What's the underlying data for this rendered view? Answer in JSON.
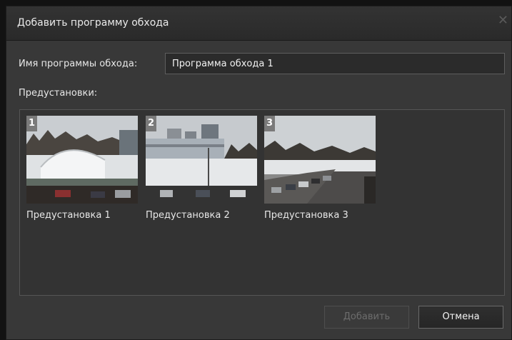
{
  "dialog": {
    "title": "Добавить программу обхода",
    "close_icon": "close-icon"
  },
  "form": {
    "name_label": "Имя программы обхода:",
    "name_value": "Программа обхода 1",
    "presets_label": "Предустановки:"
  },
  "presets": [
    {
      "number": "1",
      "label": "Предустановка 1"
    },
    {
      "number": "2",
      "label": "Предустановка 2"
    },
    {
      "number": "3",
      "label": "Предустановка 3"
    }
  ],
  "buttons": {
    "add_label": "Добавить",
    "add_enabled": false,
    "cancel_label": "Отмена"
  },
  "colors": {
    "dialog_bg": "#383838",
    "titlebar_bg": "#2e2e2e",
    "input_bg": "#2b2b2b",
    "text": "#e8e8e8",
    "disabled_text": "#6d6d6d"
  }
}
